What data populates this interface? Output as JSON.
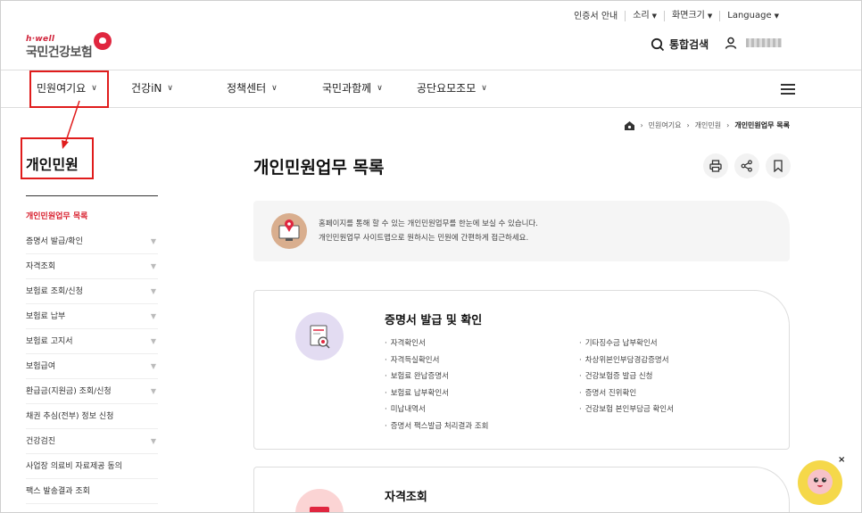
{
  "utility": {
    "cert": "인증서 안내",
    "sound": "소리",
    "screen": "화면크기",
    "language": "Language"
  },
  "logo": {
    "top": "h·well",
    "main": "국민건강보험"
  },
  "header": {
    "search": "통합검색"
  },
  "gnb": {
    "items": [
      "민원여기요",
      "건강iN",
      "정책센터",
      "국민과함께",
      "공단요모조모"
    ]
  },
  "breadcrumb": [
    "민원여기요",
    "개인민원",
    "개인민원업무 목록"
  ],
  "sidebar": {
    "title": "개인민원",
    "items": [
      "개인민원업무 목록",
      "증명서 발급/확인",
      "자격조회",
      "보험료 조회/신청",
      "보험료 납부",
      "보험료 고지서",
      "보험급여",
      "환급금(지원금) 조회/신청",
      "채권 추심(전부) 정보 신청",
      "건강검진",
      "사업장 의료비 자료제공 동의",
      "팩스 발송결과 조회"
    ]
  },
  "main": {
    "title": "개인민원업무 목록",
    "info_line1": "홈페이지를 통해 할 수 있는 개인민원업무를 한눈에 보실 수 있습니다.",
    "info_line2": "개인민원업무 사이트맵으로 원하시는 민원에 간편하게 접근하세요.",
    "card1": {
      "title": "증명서 발급 및 확인",
      "left": [
        "자격확인서",
        "자격득실확인서",
        "보험료 완납증명서",
        "보험료 납부확인서",
        "미납내역서",
        "증명서 팩스발급 처리결과 조회"
      ],
      "right": [
        "기타징수금 납부확인서",
        "차상위본인부담경감증명서",
        "건강보험증 발급 신청",
        "증명서 진위확인",
        "건강보험 본인부담금 확인서"
      ]
    },
    "card2": {
      "title": "자격조회"
    }
  },
  "colors": {
    "accent": "#e01c1c",
    "brand_red": "#e0263f"
  }
}
